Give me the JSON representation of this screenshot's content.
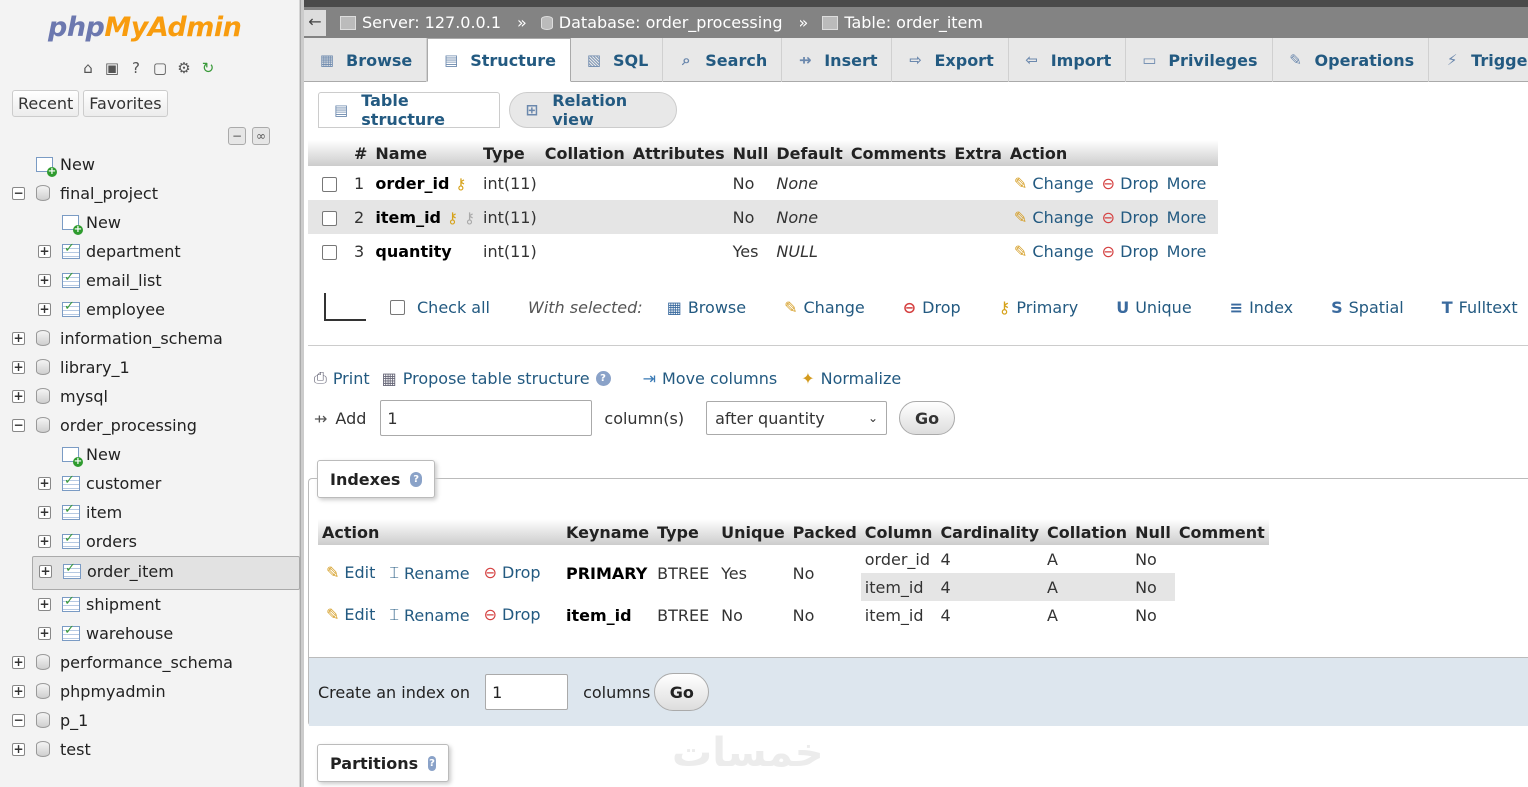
{
  "nav": {
    "logo": {
      "php": "php",
      "my": "My",
      "admin": "Admin"
    },
    "recent_label": "Recent",
    "favorites_label": "Favorites",
    "tree": [
      {
        "label": "New",
        "kind": "new",
        "level": 0
      },
      {
        "label": "final_project",
        "kind": "db",
        "level": 0,
        "state": "expanded"
      },
      {
        "label": "New",
        "kind": "new",
        "level": 1
      },
      {
        "label": "department",
        "kind": "table",
        "level": 1
      },
      {
        "label": "email_list",
        "kind": "table",
        "level": 1
      },
      {
        "label": "employee",
        "kind": "table",
        "level": 1
      },
      {
        "label": "information_schema",
        "kind": "db",
        "level": 0,
        "state": "collapsed"
      },
      {
        "label": "library_1",
        "kind": "db",
        "level": 0,
        "state": "collapsed"
      },
      {
        "label": "mysql",
        "kind": "db",
        "level": 0,
        "state": "collapsed"
      },
      {
        "label": "order_processing",
        "kind": "db",
        "level": 0,
        "state": "expanded"
      },
      {
        "label": "New",
        "kind": "new",
        "level": 1
      },
      {
        "label": "customer",
        "kind": "table",
        "level": 1
      },
      {
        "label": "item",
        "kind": "table",
        "level": 1
      },
      {
        "label": "orders",
        "kind": "table",
        "level": 1
      },
      {
        "label": "order_item",
        "kind": "table",
        "level": 1,
        "selected": true
      },
      {
        "label": "shipment",
        "kind": "table",
        "level": 1
      },
      {
        "label": "warehouse",
        "kind": "table",
        "level": 1
      },
      {
        "label": "performance_schema",
        "kind": "db",
        "level": 0,
        "state": "collapsed"
      },
      {
        "label": "phpmyadmin",
        "kind": "db",
        "level": 0,
        "state": "collapsed"
      },
      {
        "label": "p_1",
        "kind": "db",
        "level": 0,
        "state": "expanded"
      },
      {
        "label": "test",
        "kind": "db",
        "level": 0,
        "state": "collapsed"
      }
    ]
  },
  "breadcrumb": {
    "server": "Server: 127.0.0.1",
    "database": "Database: order_processing",
    "table": "Table: order_item",
    "separator": "»"
  },
  "tabs": [
    {
      "label": "Browse",
      "icon": "browse-icon"
    },
    {
      "label": "Structure",
      "icon": "structure-icon",
      "active": true
    },
    {
      "label": "SQL",
      "icon": "sql-icon"
    },
    {
      "label": "Search",
      "icon": "search-icon"
    },
    {
      "label": "Insert",
      "icon": "insert-icon"
    },
    {
      "label": "Export",
      "icon": "export-icon"
    },
    {
      "label": "Import",
      "icon": "import-icon"
    },
    {
      "label": "Privileges",
      "icon": "privileges-icon"
    },
    {
      "label": "Operations",
      "icon": "operations-icon"
    },
    {
      "label": "Triggers",
      "icon": "triggers-icon"
    }
  ],
  "subtabs": {
    "table_structure": "Table structure",
    "relation_view": "Relation view"
  },
  "structure": {
    "headers": [
      "#",
      "Name",
      "Type",
      "Collation",
      "Attributes",
      "Null",
      "Default",
      "Comments",
      "Extra",
      "Action"
    ],
    "rows": [
      {
        "num": "1",
        "name": "order_id",
        "type": "int(11)",
        "null": "No",
        "default": "None",
        "keys": [
          "primary"
        ]
      },
      {
        "num": "2",
        "name": "item_id",
        "type": "int(11)",
        "null": "No",
        "default": "None",
        "keys": [
          "primary",
          "index"
        ]
      },
      {
        "num": "3",
        "name": "quantity",
        "type": "int(11)",
        "null": "Yes",
        "default": "NULL",
        "keys": []
      }
    ],
    "row_actions": {
      "change": "Change",
      "drop": "Drop",
      "more": "More"
    }
  },
  "with_selected": {
    "check_all": "Check all",
    "label": "With selected:",
    "actions": [
      "Browse",
      "Change",
      "Drop",
      "Primary",
      "Unique",
      "Index",
      "Spatial",
      "Fulltext"
    ]
  },
  "tools": {
    "print": "Print",
    "propose": "Propose table structure",
    "move": "Move columns",
    "normalize": "Normalize"
  },
  "add_column": {
    "label": "Add",
    "value": "1",
    "unit": "column(s)",
    "position": "after quantity",
    "go": "Go"
  },
  "indexes": {
    "legend": "Indexes",
    "headers": [
      "Action",
      "Keyname",
      "Type",
      "Unique",
      "Packed",
      "Column",
      "Cardinality",
      "Collation",
      "Null",
      "Comment"
    ],
    "actions": {
      "edit": "Edit",
      "rename": "Rename",
      "drop": "Drop"
    },
    "rows": [
      {
        "keyname": "PRIMARY",
        "type": "BTREE",
        "unique": "Yes",
        "packed": "No",
        "columns": [
          {
            "column": "order_id",
            "cardinality": "4",
            "collation": "A",
            "null": "No"
          },
          {
            "column": "item_id",
            "cardinality": "4",
            "collation": "A",
            "null": "No"
          }
        ]
      },
      {
        "keyname": "item_id",
        "type": "BTREE",
        "unique": "No",
        "packed": "No",
        "columns": [
          {
            "column": "item_id",
            "cardinality": "4",
            "collation": "A",
            "null": "No"
          }
        ]
      }
    ],
    "create": {
      "label": "Create an index on",
      "value": "1",
      "unit": "columns",
      "go": "Go"
    }
  },
  "partitions": {
    "legend": "Partitions"
  },
  "watermark": "خمسات"
}
